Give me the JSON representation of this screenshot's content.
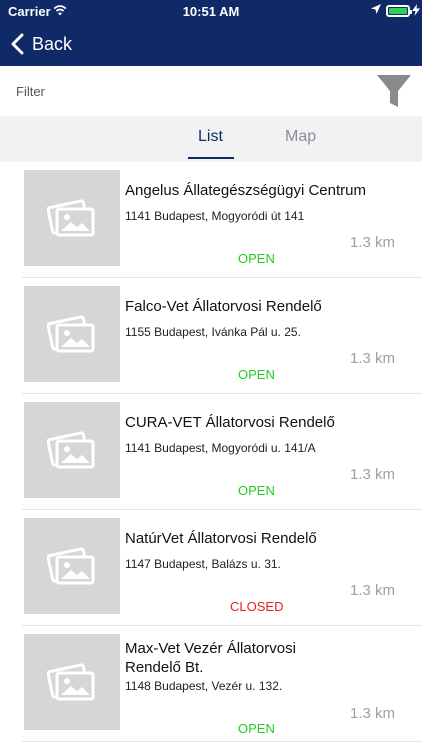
{
  "status_bar": {
    "carrier": "Carrier",
    "time": "10:51 AM"
  },
  "nav": {
    "back_label": "Back"
  },
  "filter": {
    "placeholder": "Filter"
  },
  "tabs": [
    {
      "label": "List",
      "selected": true
    },
    {
      "label": "Map",
      "selected": false
    }
  ],
  "items": [
    {
      "name": "Angelus Állategészségügyi Centrum",
      "address": "1141 Budapest, Mogyoródi út 141",
      "distance": "1.3 km",
      "status": "OPEN"
    },
    {
      "name": "Falco-Vet Állatorvosi Rendelő",
      "address": "1155 Budapest, Ivánka Pál u. 25.",
      "distance": "1.3 km",
      "status": "OPEN"
    },
    {
      "name": "CURA-VET Állatorvosi Rendelő",
      "address": "1141 Budapest, Mogyoródi u. 141/A",
      "distance": "1.3 km",
      "status": "OPEN"
    },
    {
      "name": "NatúrVet Állatorvosi Rendelő",
      "address": "1147 Budapest, Balázs u. 31.",
      "distance": "1.3 km",
      "status": "CLOSED"
    },
    {
      "name": "Max-Vet Vezér Állatorvosi Rendelő Bt.",
      "address": "1148 Budapest, Vezér u. 132.",
      "distance": "1.3 km",
      "status": "OPEN"
    }
  ],
  "colors": {
    "header": "#0f2a66",
    "open": "#22cc22",
    "closed": "#e22222"
  }
}
